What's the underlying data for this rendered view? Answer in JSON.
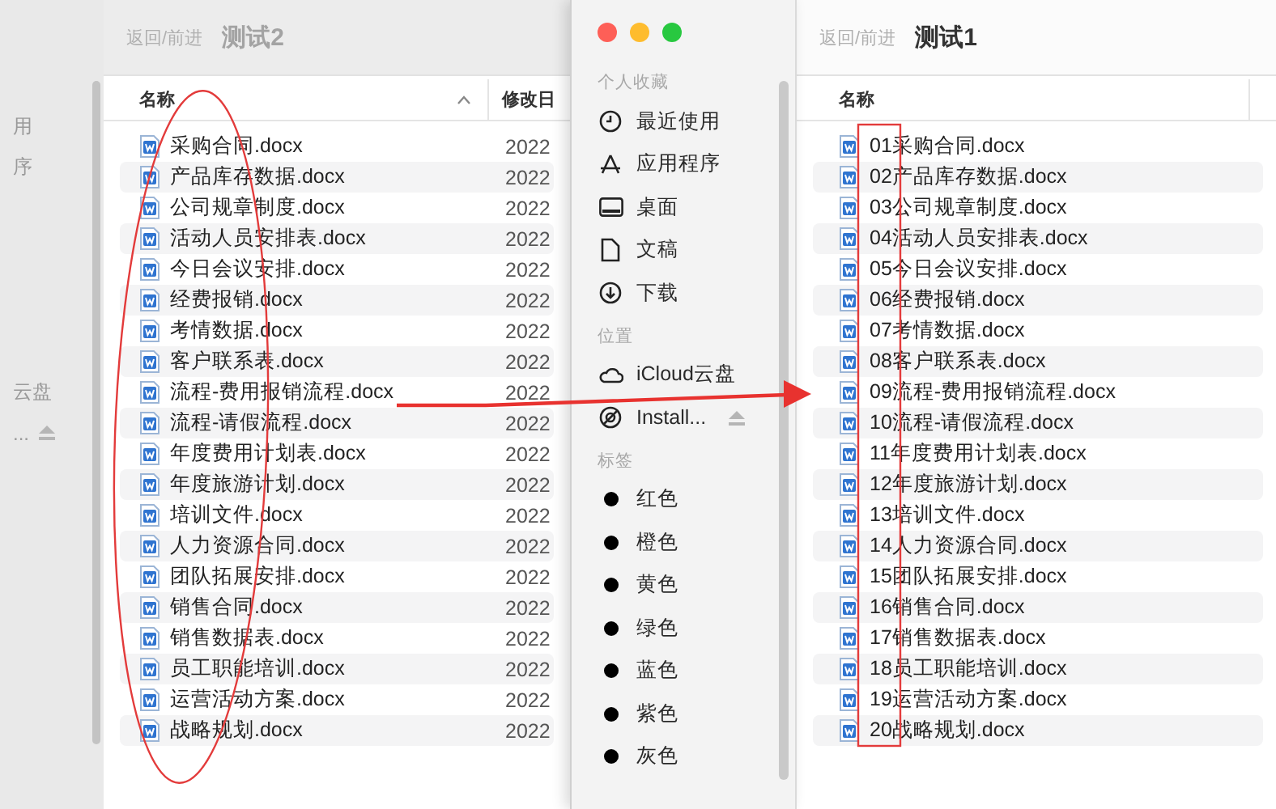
{
  "back_window": {
    "sidebar_items": [
      {
        "label": "用",
        "kind": "place"
      },
      {
        "label": "序",
        "kind": "place"
      },
      {
        "label": "云盘",
        "kind": "place"
      },
      {
        "label": "...",
        "kind": "volume"
      }
    ],
    "nav_label": "返回/前进",
    "title": "测试2",
    "columns": [
      {
        "label": "名称",
        "sorted": true
      },
      {
        "label": "修改日",
        "sorted": false
      }
    ],
    "rows": [
      {
        "name": "采购合同.docx",
        "date": "2022"
      },
      {
        "name": "产品库存数据.docx",
        "date": "2022"
      },
      {
        "name": "公司规章制度.docx",
        "date": "2022"
      },
      {
        "name": "活动人员安排表.docx",
        "date": "2022"
      },
      {
        "name": "今日会议安排.docx",
        "date": "2022"
      },
      {
        "name": "经费报销.docx",
        "date": "2022"
      },
      {
        "name": "考情数据.docx",
        "date": "2022"
      },
      {
        "name": "客户联系表.docx",
        "date": "2022"
      },
      {
        "name": "流程-费用报销流程.docx",
        "date": "2022"
      },
      {
        "name": "流程-请假流程.docx",
        "date": "2022"
      },
      {
        "name": "年度费用计划表.docx",
        "date": "2022"
      },
      {
        "name": "年度旅游计划.docx",
        "date": "2022"
      },
      {
        "name": "培训文件.docx",
        "date": "2022"
      },
      {
        "name": "人力资源合同.docx",
        "date": "2022"
      },
      {
        "name": "团队拓展安排.docx",
        "date": "2022"
      },
      {
        "name": "销售合同.docx",
        "date": "2022"
      },
      {
        "name": "销售数据表.docx",
        "date": "2022"
      },
      {
        "name": "员工职能培训.docx",
        "date": "2022"
      },
      {
        "name": "运营活动方案.docx",
        "date": "2022"
      },
      {
        "name": "战略规划.docx",
        "date": "2022"
      }
    ]
  },
  "front_window": {
    "sidebar_sections": [
      {
        "title": "个人收藏",
        "items": [
          {
            "label": "最近使用",
            "kind": "recent"
          },
          {
            "label": "应用程序",
            "kind": "apps"
          },
          {
            "label": "桌面",
            "kind": "desktop"
          },
          {
            "label": "文稿",
            "kind": "document"
          },
          {
            "label": "下载",
            "kind": "download"
          }
        ]
      },
      {
        "title": "位置",
        "items": [
          {
            "label": "iCloud云盘",
            "kind": "cloud"
          },
          {
            "label": "Install...",
            "kind": "disk"
          }
        ]
      },
      {
        "title": "标签",
        "items": [
          {
            "label": "红色",
            "kind": "tag"
          },
          {
            "label": "橙色",
            "kind": "tag"
          },
          {
            "label": "黄色",
            "kind": "tag"
          },
          {
            "label": "绿色",
            "kind": "tag"
          },
          {
            "label": "蓝色",
            "kind": "tag"
          },
          {
            "label": "紫色",
            "kind": "tag"
          },
          {
            "label": "灰色",
            "kind": "tag"
          }
        ]
      }
    ],
    "nav_label": "返回/前进",
    "title": "测试1",
    "columns": [
      {
        "label": "名称",
        "sorted": false
      }
    ],
    "rows": [
      {
        "name": "01采购合同.docx"
      },
      {
        "name": "02产品库存数据.docx"
      },
      {
        "name": "03公司规章制度.docx"
      },
      {
        "name": "04活动人员安排表.docx"
      },
      {
        "name": "05今日会议安排.docx"
      },
      {
        "name": "06经费报销.docx"
      },
      {
        "name": "07考情数据.docx"
      },
      {
        "name": "08客户联系表.docx"
      },
      {
        "name": "09流程-费用报销流程.docx"
      },
      {
        "name": "10流程-请假流程.docx"
      },
      {
        "name": "11年度费用计划表.docx"
      },
      {
        "name": "12年度旅游计划.docx"
      },
      {
        "name": "13培训文件.docx"
      },
      {
        "name": "14人力资源合同.docx"
      },
      {
        "name": "15团队拓展安排.docx"
      },
      {
        "name": "16销售合同.docx"
      },
      {
        "name": "17销售数据表.docx"
      },
      {
        "name": "18员工职能培训.docx"
      },
      {
        "name": "19运营活动方案.docx"
      },
      {
        "name": "20战略规划.docx"
      }
    ]
  },
  "annotations": [
    {
      "kind": "ellipse"
    },
    {
      "kind": "arrow"
    },
    {
      "kind": "frame"
    }
  ]
}
